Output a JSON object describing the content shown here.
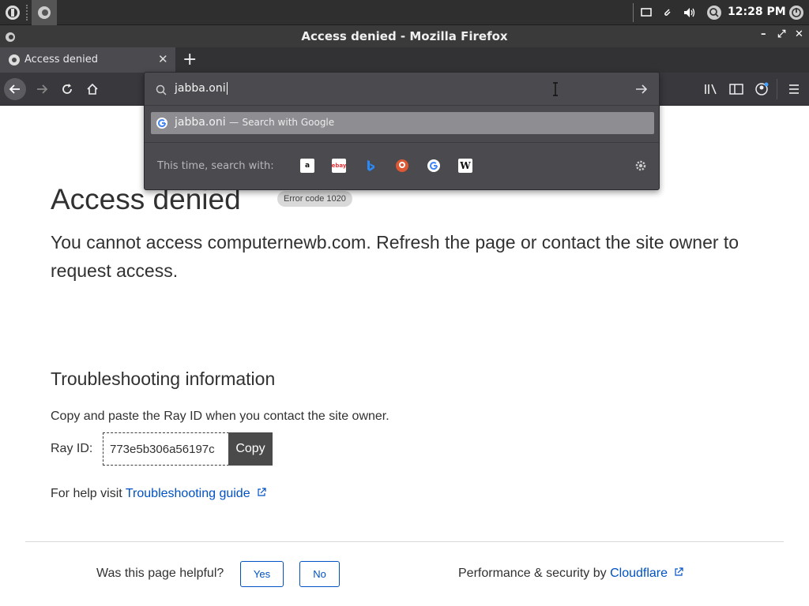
{
  "taskbar": {
    "clock": "12:28 PM"
  },
  "window": {
    "title": "Access denied - Mozilla Firefox"
  },
  "tab": {
    "label": "Access denied"
  },
  "urlbar": {
    "value": "jabba.oni",
    "suggestion": "jabba.oni",
    "suggestion_sep": "—",
    "suggestion_action": "Search with Google",
    "engines_label": "This time, search with:",
    "engines": [
      "amazon-icon",
      "ebay-icon",
      "bing-icon",
      "duckduckgo-icon",
      "google-icon",
      "wikipedia-icon"
    ]
  },
  "page": {
    "heading": "Access denied",
    "error_code": "Error code 1020",
    "lead": "You cannot access computernewb.com. Refresh the page or contact the site owner to request access.",
    "troubleshooting_heading": "Troubleshooting information",
    "copy_instruction": "Copy and paste the Ray ID when you contact the site owner.",
    "ray_label": "Ray ID:",
    "ray_id": "773e5b306a56197c",
    "copy_label": "Copy",
    "help_prefix": "For help visit",
    "help_link": "Troubleshooting guide",
    "helpful_question": "Was this page helpful?",
    "yes_label": "Yes",
    "no_label": "No",
    "perf_prefix": "Performance & security by",
    "perf_link": "Cloudflare"
  },
  "colors": {
    "link": "#0051c3",
    "ff_dark": "#38383d"
  }
}
